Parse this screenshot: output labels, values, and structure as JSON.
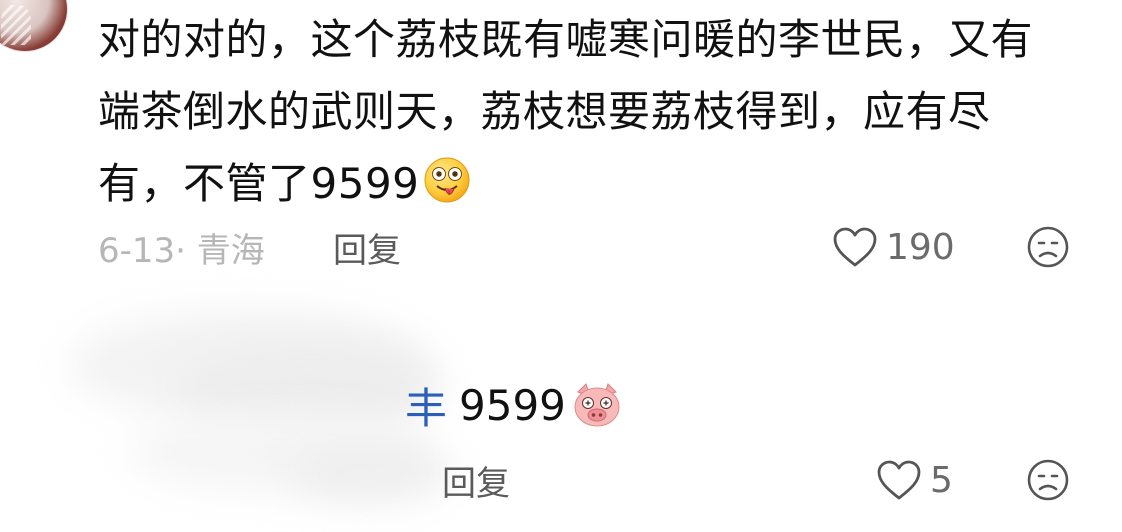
{
  "comment1": {
    "line1": "对的对的，这个荔枝既有嘘寒问暖的李世民，又有",
    "line2": "端茶倒水的武则天，荔枝想要荔枝得到，应有尽",
    "line3": "有，不管了9599",
    "emoji": "money-eyes-tongue-emoji",
    "date_location": "6-13· 青海",
    "reply_label": "回复",
    "like_count": "190"
  },
  "comment2": {
    "prefix": "丰",
    "text": "9599",
    "emoji": "pig-face-emoji",
    "reply_label": "回复",
    "like_count": "5"
  },
  "icons": {
    "like": "heart-outline-icon",
    "dislike": "sad-face-icon"
  },
  "colors": {
    "text_primary": "#111111",
    "text_meta": "#b6b6b6",
    "text_reply": "#5a5a5a",
    "icon_gray": "#555555",
    "emoji_yellow": "#ffd24a",
    "pig_pink": "#f7b6b6",
    "tally_blue": "#2b5fb8"
  }
}
